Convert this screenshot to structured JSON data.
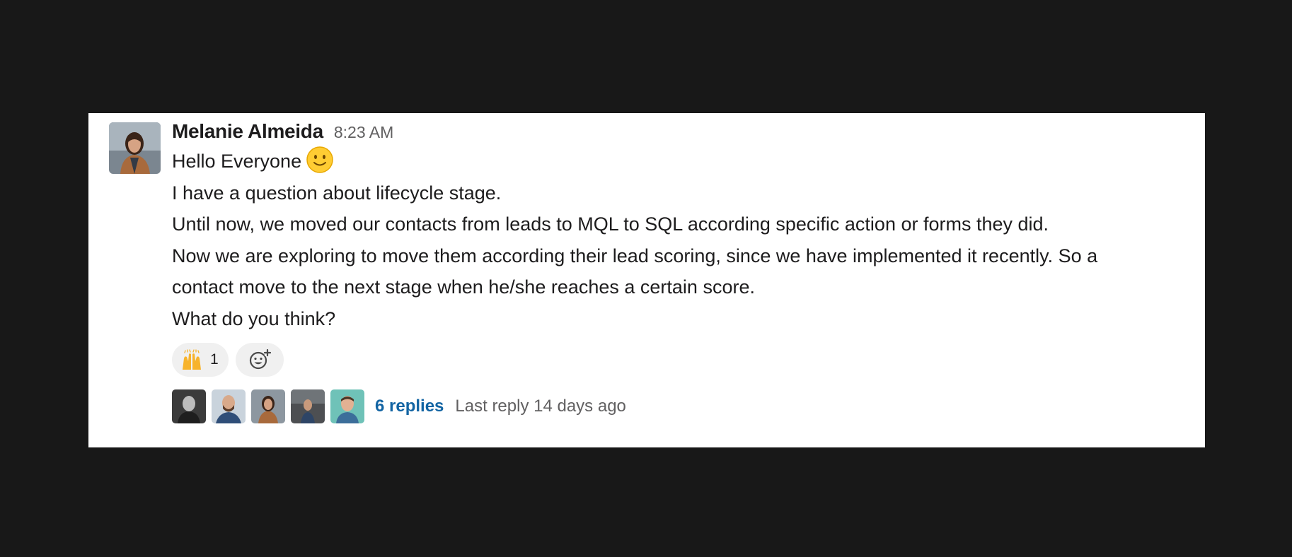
{
  "message": {
    "sender": "Melanie Almeida",
    "time": "8:23 AM",
    "line1": "Hello Everyone",
    "line1_emoji": "slightly-smiling-face",
    "lines": [
      "I have a question about lifecycle stage.",
      "Until now, we moved our contacts from leads to MQL to SQL according specific action or forms they did.",
      "Now we are exploring to move them according their lead scoring, since we have implemented it recently. So a",
      "contact move to the next stage when he/she reaches a certain score.",
      "What do you think?"
    ]
  },
  "reactions": [
    {
      "emoji": "raised-hands",
      "count": "1"
    }
  ],
  "add_reaction_icon": "add-reaction-icon",
  "thread": {
    "participant_count": 5,
    "replies_label": "6 replies",
    "last_reply": "Last reply 14 days ago"
  },
  "colors": {
    "background": "#181818",
    "card": "#ffffff",
    "link": "#1264a3",
    "muted": "#616061",
    "text": "#1d1c1d"
  }
}
